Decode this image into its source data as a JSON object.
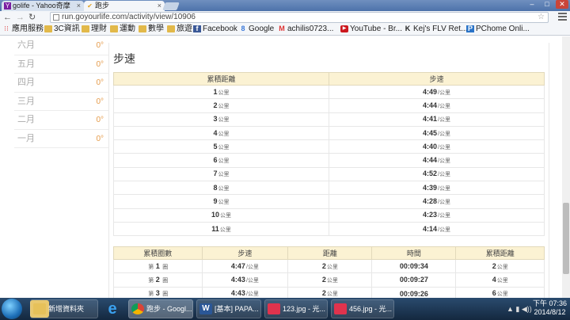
{
  "browser": {
    "tabs": [
      {
        "title": "golife - Yahoo奇摩",
        "icon": "Y",
        "active": false
      },
      {
        "title": "跑步",
        "icon": "✔",
        "active": true
      }
    ],
    "url": "run.goyourlife.com/activity/view/10906",
    "bookmarks": [
      {
        "label": "應用服務",
        "icon": "apps-icon"
      },
      {
        "label": "3C資訊",
        "icon": "folder-icon"
      },
      {
        "label": "理財",
        "icon": "folder-icon"
      },
      {
        "label": "運動",
        "icon": "folder-icon"
      },
      {
        "label": "數學",
        "icon": "folder-icon"
      },
      {
        "label": "旅遊",
        "icon": "folder-icon"
      },
      {
        "label": "Facebook",
        "icon": "facebook-icon"
      },
      {
        "label": "Google",
        "icon": "google-icon"
      },
      {
        "label": "achilis0723...",
        "icon": "gmail-icon"
      },
      {
        "label": "YouTube - Br...",
        "icon": "youtube-icon"
      },
      {
        "label": "Kej's FLV Ret...",
        "icon": "k-icon"
      },
      {
        "label": "PChome Onli...",
        "icon": "pchome-icon"
      }
    ]
  },
  "sidebar": {
    "months": [
      {
        "label": "六月",
        "value": "0°"
      },
      {
        "label": "五月",
        "value": "0°"
      },
      {
        "label": "四月",
        "value": "0°"
      },
      {
        "label": "三月",
        "value": "0°"
      },
      {
        "label": "二月",
        "value": "0°"
      },
      {
        "label": "一月",
        "value": "0°"
      }
    ]
  },
  "pace_section": {
    "title": "步速",
    "headers": [
      "累積距離",
      "步速"
    ],
    "unit_km": "公里",
    "unit_per_km": "/公里",
    "rows": [
      {
        "km": "1",
        "pace": "4:49"
      },
      {
        "km": "2",
        "pace": "4:44"
      },
      {
        "km": "3",
        "pace": "4:41"
      },
      {
        "km": "4",
        "pace": "4:45"
      },
      {
        "km": "5",
        "pace": "4:40"
      },
      {
        "km": "6",
        "pace": "4:44"
      },
      {
        "km": "7",
        "pace": "4:52"
      },
      {
        "km": "8",
        "pace": "4:39"
      },
      {
        "km": "9",
        "pace": "4:28"
      },
      {
        "km": "10",
        "pace": "4:23"
      },
      {
        "km": "11",
        "pace": "4:14"
      }
    ]
  },
  "lap_section": {
    "headers": [
      "累積圈數",
      "步速",
      "距離",
      "時間",
      "累積距離"
    ],
    "lap_prefix": "第",
    "lap_suffix": "圈",
    "rows": [
      {
        "lap": "1",
        "pace": "4:47",
        "distance": "2",
        "time": "00:09:34",
        "cumulative": "2"
      },
      {
        "lap": "2",
        "pace": "4:43",
        "distance": "2",
        "time": "00:09:27",
        "cumulative": "4"
      },
      {
        "lap": "3",
        "pace": "4:43",
        "distance": "2",
        "time": "00:09:26",
        "cumulative": "6"
      }
    ]
  },
  "taskbar": {
    "items": [
      {
        "label": "新增資料夾",
        "icon": "folder-icon"
      },
      {
        "label": "跑步 - Googl...",
        "icon": "chrome-icon",
        "active": true
      },
      {
        "label": "[基本] PAPA...",
        "icon": "word-icon"
      },
      {
        "label": "123.jpg - 光...",
        "icon": "photo-icon"
      },
      {
        "label": "456.jpg - 光...",
        "icon": "photo-icon"
      }
    ],
    "time": "下午 07:36",
    "date": "2014/8/12"
  },
  "colors": {
    "header_bg": "#fbf2d3",
    "degree": "#e59b4a",
    "tab_strip": "#4d72aa"
  }
}
